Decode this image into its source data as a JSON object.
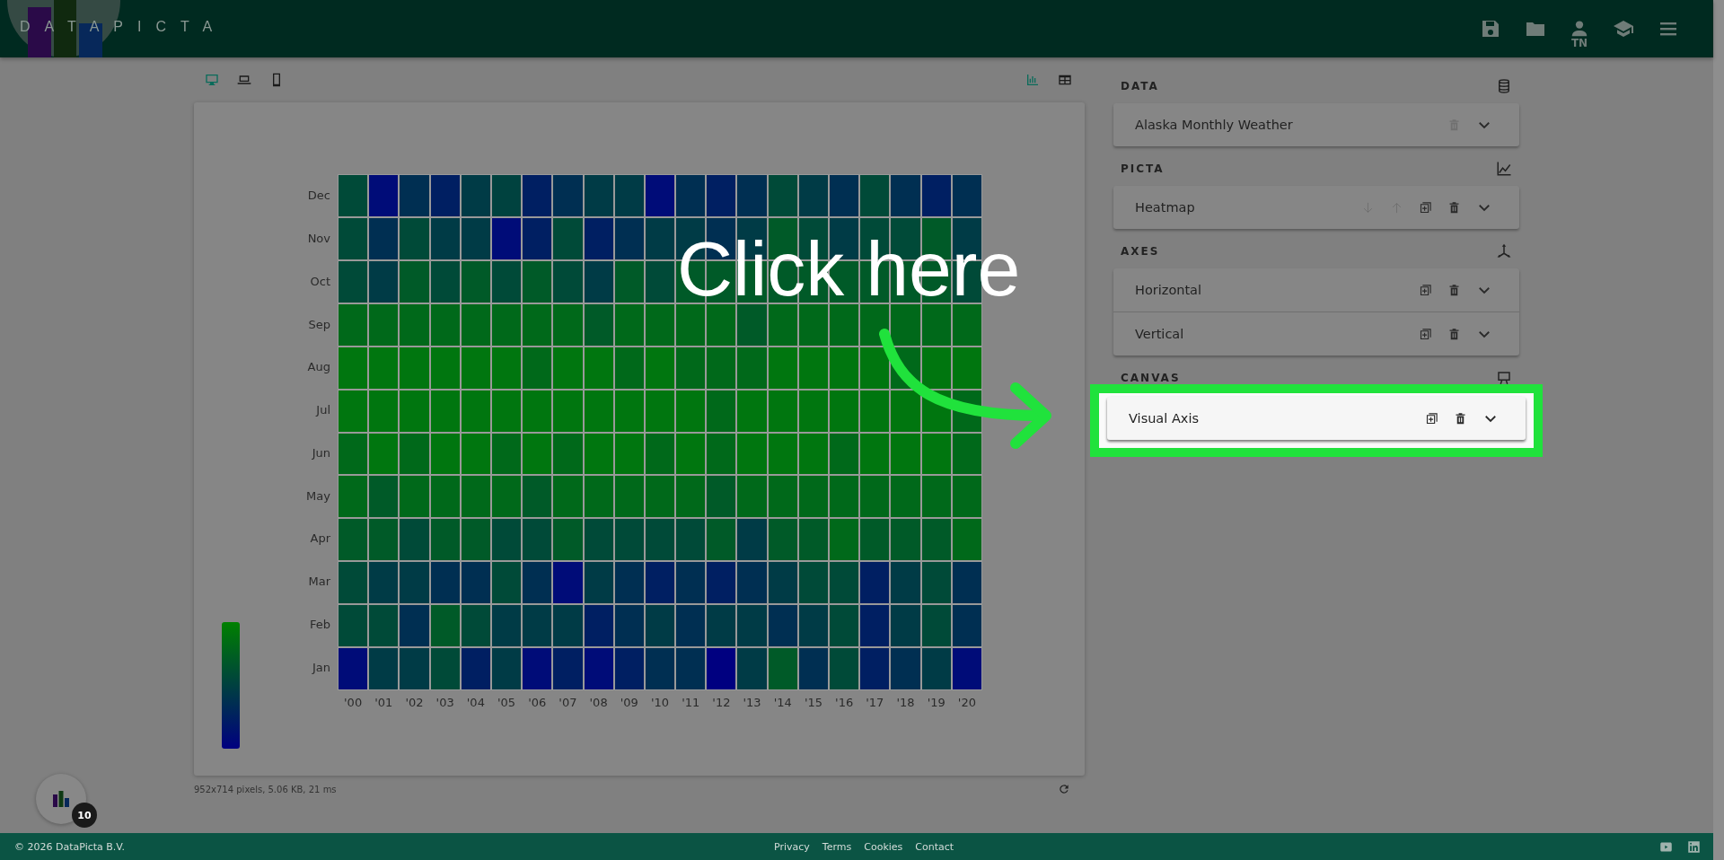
{
  "header": {
    "logo_text": "DATAPICTA",
    "actions": [
      {
        "kind": "save"
      },
      {
        "kind": "folder"
      },
      {
        "kind": "user",
        "caption": "TN"
      },
      {
        "kind": "school"
      },
      {
        "kind": "menu"
      }
    ]
  },
  "view_toggles": [
    {
      "kind": "desktop",
      "selected": true
    },
    {
      "kind": "laptop",
      "selected": false
    },
    {
      "kind": "phone",
      "selected": false
    }
  ],
  "mode_toggles": [
    {
      "kind": "chart",
      "selected": true
    },
    {
      "kind": "table",
      "selected": false
    }
  ],
  "heatmap": {
    "columns": [
      "'00",
      "'01",
      "'02",
      "'03",
      "'04",
      "'05",
      "'06",
      "'07",
      "'08",
      "'09",
      "'10",
      "'11",
      "'12",
      "'13",
      "'14",
      "'15",
      "'16",
      "'17",
      "'18",
      "'19",
      "'20"
    ],
    "rows": [
      {
        "label": "Dec",
        "cells": [
          {
            "color": "#004a38"
          },
          {
            "color": "#000c78"
          },
          {
            "color": "#002f52"
          },
          {
            "color": "#001f62"
          },
          {
            "color": "#003b46"
          },
          {
            "color": "#00423f"
          },
          {
            "color": "#001f62"
          },
          {
            "color": "#002f52"
          },
          {
            "color": "#003b46"
          },
          {
            "color": "#003b46"
          },
          {
            "color": "#000c78"
          },
          {
            "color": "#002f52"
          },
          {
            "color": "#001f62"
          },
          {
            "color": "#002f52"
          },
          {
            "color": "#004a38"
          },
          {
            "color": "#003b46"
          },
          {
            "color": "#002f52"
          },
          {
            "color": "#004a38"
          },
          {
            "color": "#002f52"
          },
          {
            "color": "#001f62"
          },
          {
            "color": "#002f52"
          }
        ]
      },
      {
        "label": "Nov",
        "cells": [
          {
            "color": "#004a38"
          },
          {
            "color": "#002f52"
          },
          {
            "color": "#004a38"
          },
          {
            "color": "#003b46"
          },
          {
            "color": "#003b46"
          },
          {
            "color": "#000c78"
          },
          {
            "color": "#001f62"
          },
          {
            "color": "#004a38"
          },
          {
            "color": "#001f62"
          },
          {
            "color": "#002f52"
          },
          {
            "color": "#003b46"
          },
          {
            "color": "#003b46"
          },
          {
            "color": "#002f52"
          },
          {
            "color": "#003b46"
          },
          {
            "color": "#005a28"
          },
          {
            "color": "#004a38"
          },
          {
            "color": "#003b46"
          },
          {
            "color": "#004a38"
          },
          {
            "color": "#004a38"
          },
          {
            "color": "#005a28"
          },
          {
            "color": "#003b46"
          }
        ]
      },
      {
        "label": "Oct",
        "cells": [
          {
            "color": "#004a38"
          },
          {
            "color": "#003b46"
          },
          {
            "color": "#005a28"
          },
          {
            "color": "#004a38"
          },
          {
            "color": "#005a28"
          },
          {
            "color": "#004a38"
          },
          {
            "color": "#005a28"
          },
          {
            "color": "#004a38"
          },
          {
            "color": "#003b46"
          },
          {
            "color": "#005a28"
          },
          {
            "color": "#004a38"
          },
          {
            "color": "#005a28"
          },
          {
            "color": "#005a28"
          },
          {
            "color": "#005a28"
          },
          {
            "color": "#005a28"
          },
          {
            "color": "#005a28"
          },
          {
            "color": "#005a28"
          },
          {
            "color": "#005a28"
          },
          {
            "color": "#005a28"
          },
          {
            "color": "#005a28"
          },
          {
            "color": "#004a38"
          }
        ]
      },
      {
        "label": "Sep",
        "cells": [
          {
            "color": "#00691a"
          },
          {
            "color": "#00691a"
          },
          {
            "color": "#00691a"
          },
          {
            "color": "#00691a"
          },
          {
            "color": "#00691a"
          },
          {
            "color": "#00691a"
          },
          {
            "color": "#00691a"
          },
          {
            "color": "#00691a"
          },
          {
            "color": "#005a28"
          },
          {
            "color": "#00691a"
          },
          {
            "color": "#00691a"
          },
          {
            "color": "#00691a"
          },
          {
            "color": "#00691a"
          },
          {
            "color": "#005a28"
          },
          {
            "color": "#00691a"
          },
          {
            "color": "#00691a"
          },
          {
            "color": "#00691a"
          },
          {
            "color": "#00691a"
          },
          {
            "color": "#00691a"
          },
          {
            "color": "#00691a"
          },
          {
            "color": "#00691a"
          }
        ]
      },
      {
        "label": "Aug",
        "cells": [
          {
            "color": "#00760f"
          },
          {
            "color": "#00760f"
          },
          {
            "color": "#00760f"
          },
          {
            "color": "#00760f"
          },
          {
            "color": "#00760f"
          },
          {
            "color": "#00760f"
          },
          {
            "color": "#00691a"
          },
          {
            "color": "#00760f"
          },
          {
            "color": "#00760f"
          },
          {
            "color": "#00691a"
          },
          {
            "color": "#00760f"
          },
          {
            "color": "#00691a"
          },
          {
            "color": "#00691a"
          },
          {
            "color": "#00691a"
          },
          {
            "color": "#00760f"
          },
          {
            "color": "#00760f"
          },
          {
            "color": "#00760f"
          },
          {
            "color": "#00760f"
          },
          {
            "color": "#00691a"
          },
          {
            "color": "#00760f"
          },
          {
            "color": "#00760f"
          }
        ]
      },
      {
        "label": "Jul",
        "cells": [
          {
            "color": "#00760f"
          },
          {
            "color": "#00760f"
          },
          {
            "color": "#00760f"
          },
          {
            "color": "#00760f"
          },
          {
            "color": "#00760f"
          },
          {
            "color": "#00760f"
          },
          {
            "color": "#00760f"
          },
          {
            "color": "#00760f"
          },
          {
            "color": "#00760f"
          },
          {
            "color": "#00760f"
          },
          {
            "color": "#00760f"
          },
          {
            "color": "#00760f"
          },
          {
            "color": "#00691a"
          },
          {
            "color": "#00760f"
          },
          {
            "color": "#00760f"
          },
          {
            "color": "#00760f"
          },
          {
            "color": "#00760f"
          },
          {
            "color": "#00760f"
          },
          {
            "color": "#00760f"
          },
          {
            "color": "#00760f"
          },
          {
            "color": "#00691a"
          }
        ]
      },
      {
        "label": "Jun",
        "cells": [
          {
            "color": "#00691a"
          },
          {
            "color": "#00760f"
          },
          {
            "color": "#00691a"
          },
          {
            "color": "#00760f"
          },
          {
            "color": "#00760f"
          },
          {
            "color": "#00691a"
          },
          {
            "color": "#00760f"
          },
          {
            "color": "#00691a"
          },
          {
            "color": "#00760f"
          },
          {
            "color": "#00760f"
          },
          {
            "color": "#00691a"
          },
          {
            "color": "#00760f"
          },
          {
            "color": "#00691a"
          },
          {
            "color": "#00760f"
          },
          {
            "color": "#00760f"
          },
          {
            "color": "#00760f"
          },
          {
            "color": "#00691a"
          },
          {
            "color": "#00760f"
          },
          {
            "color": "#00760f"
          },
          {
            "color": "#00760f"
          },
          {
            "color": "#00691a"
          }
        ]
      },
      {
        "label": "May",
        "cells": [
          {
            "color": "#00691a"
          },
          {
            "color": "#005a28"
          },
          {
            "color": "#00691a"
          },
          {
            "color": "#00691a"
          },
          {
            "color": "#00691a"
          },
          {
            "color": "#00691a"
          },
          {
            "color": "#005a28"
          },
          {
            "color": "#00691a"
          },
          {
            "color": "#00691a"
          },
          {
            "color": "#00691a"
          },
          {
            "color": "#00691a"
          },
          {
            "color": "#00691a"
          },
          {
            "color": "#005a28"
          },
          {
            "color": "#00691a"
          },
          {
            "color": "#00691a"
          },
          {
            "color": "#00691a"
          },
          {
            "color": "#00691a"
          },
          {
            "color": "#00691a"
          },
          {
            "color": "#00691a"
          },
          {
            "color": "#00691a"
          },
          {
            "color": "#00691a"
          }
        ]
      },
      {
        "label": "Apr",
        "cells": [
          {
            "color": "#005a28"
          },
          {
            "color": "#005a28"
          },
          {
            "color": "#004a38"
          },
          {
            "color": "#005a28"
          },
          {
            "color": "#005a28"
          },
          {
            "color": "#004a38"
          },
          {
            "color": "#004a38"
          },
          {
            "color": "#005a28"
          },
          {
            "color": "#004a38"
          },
          {
            "color": "#004a38"
          },
          {
            "color": "#004a38"
          },
          {
            "color": "#004a38"
          },
          {
            "color": "#005a28"
          },
          {
            "color": "#003b46"
          },
          {
            "color": "#005a28"
          },
          {
            "color": "#005a28"
          },
          {
            "color": "#00691a"
          },
          {
            "color": "#005a28"
          },
          {
            "color": "#005a28"
          },
          {
            "color": "#005a28"
          },
          {
            "color": "#00691a"
          }
        ]
      },
      {
        "label": "Mar",
        "cells": [
          {
            "color": "#004a38"
          },
          {
            "color": "#003b46"
          },
          {
            "color": "#003b46"
          },
          {
            "color": "#002f52"
          },
          {
            "color": "#002f52"
          },
          {
            "color": "#004a38"
          },
          {
            "color": "#002f52"
          },
          {
            "color": "#000c78"
          },
          {
            "color": "#003b46"
          },
          {
            "color": "#002f52"
          },
          {
            "color": "#001f62"
          },
          {
            "color": "#002f52"
          },
          {
            "color": "#001f62"
          },
          {
            "color": "#002f52"
          },
          {
            "color": "#003b46"
          },
          {
            "color": "#004a38"
          },
          {
            "color": "#004a38"
          },
          {
            "color": "#001f62"
          },
          {
            "color": "#003b46"
          },
          {
            "color": "#004a38"
          },
          {
            "color": "#002f52"
          }
        ]
      },
      {
        "label": "Feb",
        "cells": [
          {
            "color": "#004a38"
          },
          {
            "color": "#004a38"
          },
          {
            "color": "#002f52"
          },
          {
            "color": "#005a28"
          },
          {
            "color": "#004a38"
          },
          {
            "color": "#003b46"
          },
          {
            "color": "#003b46"
          },
          {
            "color": "#003b46"
          },
          {
            "color": "#001f62"
          },
          {
            "color": "#002f52"
          },
          {
            "color": "#003b46"
          },
          {
            "color": "#002f52"
          },
          {
            "color": "#003b46"
          },
          {
            "color": "#003b46"
          },
          {
            "color": "#002f52"
          },
          {
            "color": "#003b46"
          },
          {
            "color": "#004a38"
          },
          {
            "color": "#001f62"
          },
          {
            "color": "#003b46"
          },
          {
            "color": "#004a38"
          },
          {
            "color": "#002f52"
          }
        ]
      },
      {
        "label": "Jan",
        "cells": [
          {
            "color": "#000c78"
          },
          {
            "color": "#003b46"
          },
          {
            "color": "#003b46"
          },
          {
            "color": "#004a38"
          },
          {
            "color": "#001f62"
          },
          {
            "color": "#003b46"
          },
          {
            "color": "#000c78"
          },
          {
            "color": "#001f62"
          },
          {
            "color": "#000c78"
          },
          {
            "color": "#001f62"
          },
          {
            "color": "#002f52"
          },
          {
            "color": "#002f52"
          },
          {
            "color": "#000080"
          },
          {
            "color": "#003b46"
          },
          {
            "color": "#005a28"
          },
          {
            "color": "#002f52"
          },
          {
            "color": "#004a38"
          },
          {
            "color": "#001f62"
          },
          {
            "color": "#002f52"
          },
          {
            "color": "#003b46"
          },
          {
            "color": "#000c78"
          }
        ]
      }
    ]
  },
  "status_text": "952x714 pixels, 5.06 KB, 21 ms",
  "panel": {
    "sections": [
      {
        "title": "DATA",
        "kind": "database",
        "items": [
          {
            "label": "Alaska Monthly Weather",
            "highlighted": false,
            "actions": [
              {
                "kind": "delete",
                "disabled": true
              },
              {
                "kind": "expand",
                "disabled": false
              }
            ]
          }
        ]
      },
      {
        "title": "PICTA",
        "kind": "chart",
        "items": [
          {
            "label": "Heatmap",
            "highlighted": false,
            "actions": [
              {
                "kind": "down",
                "disabled": true
              },
              {
                "kind": "up",
                "disabled": true
              },
              {
                "kind": "duplicate",
                "disabled": false
              },
              {
                "kind": "delete",
                "disabled": false
              },
              {
                "kind": "expand",
                "disabled": false
              }
            ]
          }
        ]
      },
      {
        "title": "AXES",
        "kind": "axes",
        "items": [
          {
            "label": "Horizontal",
            "highlighted": false,
            "actions": [
              {
                "kind": "duplicate",
                "disabled": false
              },
              {
                "kind": "delete",
                "disabled": false
              },
              {
                "kind": "expand",
                "disabled": false
              }
            ]
          },
          {
            "label": "Vertical",
            "highlighted": false,
            "actions": [
              {
                "kind": "duplicate",
                "disabled": false
              },
              {
                "kind": "delete",
                "disabled": false
              },
              {
                "kind": "expand",
                "disabled": false
              }
            ]
          }
        ]
      },
      {
        "title": "CANVAS",
        "kind": "easel",
        "items": [
          {
            "label": "Visual Axis",
            "highlighted": true,
            "actions": [
              {
                "kind": "duplicate",
                "disabled": false
              },
              {
                "kind": "delete",
                "disabled": false
              },
              {
                "kind": "expand",
                "disabled": false
              }
            ]
          }
        ]
      }
    ]
  },
  "tutorial": {
    "callout": "Click here"
  },
  "floating_button": {
    "badge": "10"
  },
  "footer": {
    "copyright": "© 2026 DataPicta B.V.",
    "links": [
      "Privacy",
      "Terms",
      "Cookies",
      "Contact"
    ],
    "social": [
      {
        "kind": "youtube"
      },
      {
        "kind": "linkedin"
      }
    ]
  }
}
